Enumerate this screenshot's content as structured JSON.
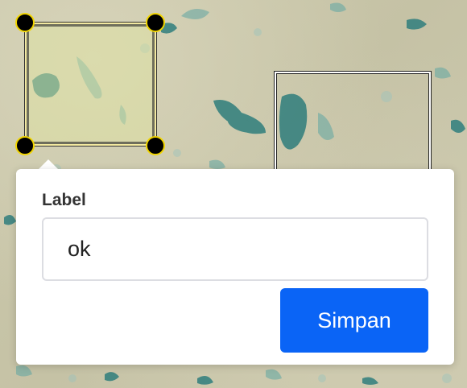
{
  "popup": {
    "label": "Label",
    "input_value": "ok",
    "save_label": "Simpan"
  },
  "colors": {
    "accent": "#0a64f6",
    "handle_border": "#f0d400",
    "stain": "#2e7f7a"
  }
}
